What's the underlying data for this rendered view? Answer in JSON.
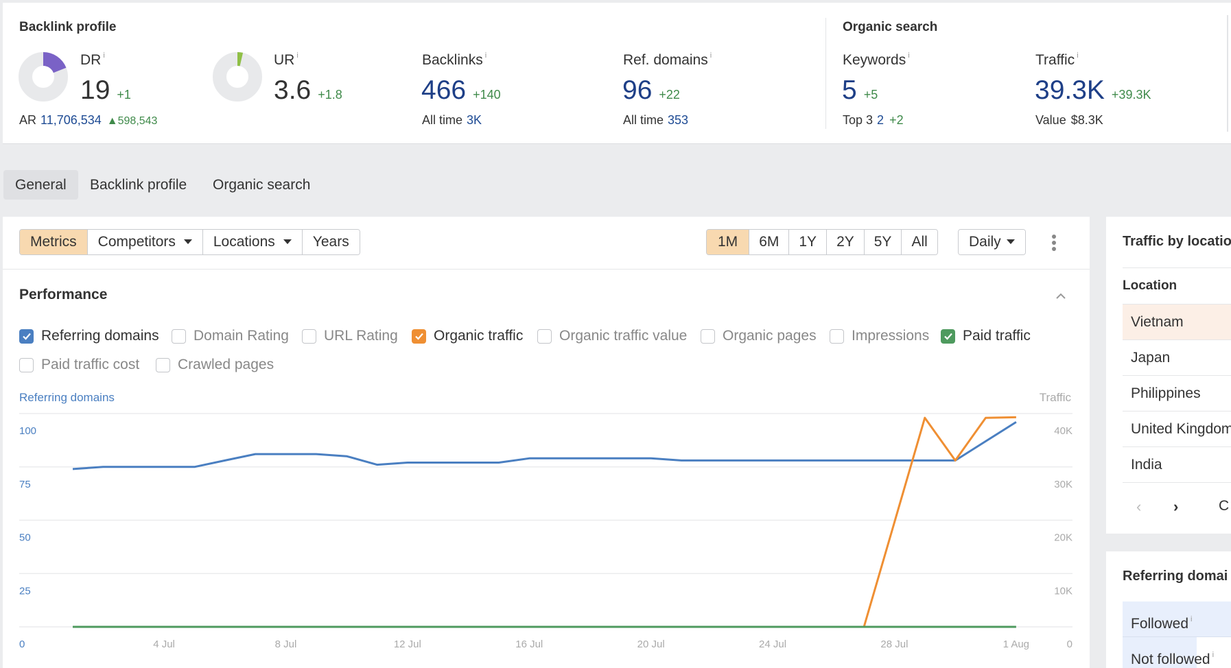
{
  "summary": {
    "backlink_profile": {
      "title": "Backlink profile",
      "dr": {
        "label": "DR",
        "value": "19",
        "delta": "+1",
        "fraction": 0.19,
        "color": "#7a62c6"
      },
      "ar": {
        "label": "AR",
        "value": "11,706,534",
        "delta": "▲598,543"
      },
      "ur": {
        "label": "UR",
        "value": "3.6",
        "delta": "+1.8",
        "fraction": 0.036,
        "color": "#8fbf46"
      },
      "backlinks": {
        "label": "Backlinks",
        "value": "466",
        "delta": "+140",
        "sub_label": "All time",
        "sub_value": "3K"
      },
      "ref_domains": {
        "label": "Ref. domains",
        "value": "96",
        "delta": "+22",
        "sub_label": "All time",
        "sub_value": "353"
      }
    },
    "organic_search": {
      "title": "Organic search",
      "keywords": {
        "label": "Keywords",
        "value": "5",
        "delta": "+5",
        "sub_label": "Top 3",
        "sub_value": "2",
        "sub_delta": "+2"
      },
      "traffic": {
        "label": "Traffic",
        "value": "39.3K",
        "delta": "+39.3K",
        "sub_label": "Value",
        "sub_value": "$8.3K"
      }
    },
    "info_glyph": "i"
  },
  "tabs": [
    {
      "label": "General",
      "active": true
    },
    {
      "label": "Backlink profile",
      "active": false
    },
    {
      "label": "Organic search",
      "active": false
    }
  ],
  "toolbar": {
    "left": [
      {
        "label": "Metrics",
        "active": true,
        "dropdown": false
      },
      {
        "label": "Competitors",
        "active": false,
        "dropdown": true
      },
      {
        "label": "Locations",
        "active": false,
        "dropdown": true
      },
      {
        "label": "Years",
        "active": false,
        "dropdown": false
      }
    ],
    "ranges": [
      {
        "label": "1M",
        "active": true
      },
      {
        "label": "6M",
        "active": false
      },
      {
        "label": "1Y",
        "active": false
      },
      {
        "label": "2Y",
        "active": false
      },
      {
        "label": "5Y",
        "active": false
      },
      {
        "label": "All",
        "active": false
      }
    ],
    "interval": "Daily"
  },
  "performance": {
    "title": "Performance",
    "checkboxes": [
      {
        "label": "Referring domains",
        "checked": true,
        "color": "#4a7fc1"
      },
      {
        "label": "Domain Rating",
        "checked": false
      },
      {
        "label": "URL Rating",
        "checked": false
      },
      {
        "label": "Organic traffic",
        "checked": true,
        "color": "#ef8f33"
      },
      {
        "label": "Organic traffic value",
        "checked": false
      },
      {
        "label": "Organic pages",
        "checked": false
      },
      {
        "label": "Impressions",
        "checked": false
      },
      {
        "label": "Paid traffic",
        "checked": true,
        "color": "#4e9a5e"
      },
      {
        "label": "Paid traffic cost",
        "checked": false
      },
      {
        "label": "Crawled pages",
        "checked": false
      }
    ]
  },
  "chart_data": {
    "type": "line",
    "title": "Performance",
    "left_axis": {
      "label": "Referring domains",
      "range": [
        0,
        100
      ],
      "ticks": [
        "0",
        "25",
        "50",
        "75",
        "100"
      ],
      "color": "#4a7fc1"
    },
    "right_axis": {
      "label": "Traffic",
      "range": [
        0,
        40000
      ],
      "ticks": [
        "0",
        "10K",
        "20K",
        "30K",
        "40K"
      ]
    },
    "x_ticks": [
      "4 Jul",
      "8 Jul",
      "12 Jul",
      "16 Jul",
      "20 Jul",
      "24 Jul",
      "28 Jul",
      "1 Aug"
    ],
    "x_tick_days": [
      4,
      8,
      12,
      16,
      20,
      24,
      28,
      32
    ],
    "x_range_days": [
      1,
      32
    ],
    "grid": true,
    "series": [
      {
        "name": "Referring domains",
        "axis": "left",
        "color": "#4a7fc1",
        "points": [
          [
            1,
            74
          ],
          [
            2,
            75
          ],
          [
            3,
            75
          ],
          [
            4,
            75
          ],
          [
            5,
            75
          ],
          [
            6,
            78
          ],
          [
            7,
            81
          ],
          [
            8,
            81
          ],
          [
            9,
            81
          ],
          [
            10,
            80
          ],
          [
            11,
            76
          ],
          [
            12,
            77
          ],
          [
            13,
            77
          ],
          [
            14,
            77
          ],
          [
            15,
            77
          ],
          [
            16,
            79
          ],
          [
            17,
            79
          ],
          [
            18,
            79
          ],
          [
            19,
            79
          ],
          [
            20,
            79
          ],
          [
            21,
            78
          ],
          [
            22,
            78
          ],
          [
            23,
            78
          ],
          [
            24,
            78
          ],
          [
            25,
            78
          ],
          [
            26,
            78
          ],
          [
            27,
            78
          ],
          [
            28,
            78
          ],
          [
            29,
            78
          ],
          [
            30,
            78
          ],
          [
            31,
            87
          ],
          [
            32,
            96
          ]
        ]
      },
      {
        "name": "Organic traffic",
        "axis": "right",
        "color": "#ef8f33",
        "points": [
          [
            1,
            0
          ],
          [
            27,
            0
          ],
          [
            28,
            19600
          ],
          [
            29,
            39200
          ],
          [
            30,
            31200
          ],
          [
            31,
            39200
          ],
          [
            32,
            39300
          ]
        ]
      },
      {
        "name": "Paid traffic",
        "axis": "right",
        "color": "#4e9a5e",
        "points": [
          [
            1,
            0
          ],
          [
            32,
            0
          ]
        ]
      }
    ]
  },
  "traffic_by_location": {
    "title": "Traffic by locatio",
    "column": "Location",
    "rows": [
      "Vietnam",
      "Japan",
      "Philippines",
      "United Kingdom",
      "India"
    ],
    "highlighted": 0,
    "pager_prev": "‹",
    "pager_next": "›",
    "pager_more": "C"
  },
  "referring_domains": {
    "title": "Referring domai",
    "rows": [
      {
        "label": "Followed"
      },
      {
        "label": "Not followed"
      }
    ]
  }
}
